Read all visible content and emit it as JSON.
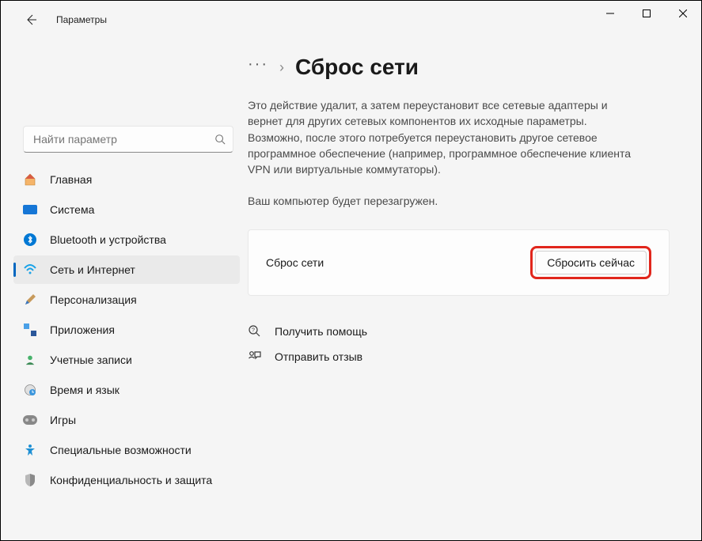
{
  "app_title": "Параметры",
  "search": {
    "placeholder": "Найти параметр"
  },
  "sidebar": {
    "items": [
      {
        "label": "Главная"
      },
      {
        "label": "Система"
      },
      {
        "label": "Bluetooth и устройства"
      },
      {
        "label": "Сеть и Интернет"
      },
      {
        "label": "Персонализация"
      },
      {
        "label": "Приложения"
      },
      {
        "label": "Учетные записи"
      },
      {
        "label": "Время и язык"
      },
      {
        "label": "Игры"
      },
      {
        "label": "Специальные возможности"
      },
      {
        "label": "Конфиденциальность и защита"
      }
    ]
  },
  "breadcrumb": {
    "ellipsis": "···",
    "sep": "›",
    "title": "Сброс сети"
  },
  "main": {
    "description": "Это действие удалит, а затем переустановит все сетевые адаптеры и вернет для других сетевых компонентов их исходные параметры. Возможно, после этого потребуется переустановить другое сетевое программное обеспечение (например, программное обеспечение клиента VPN или виртуальные коммутаторы).",
    "restart_note": "Ваш компьютер будет перезагружен.",
    "card_label": "Сброс сети",
    "reset_button": "Сбросить сейчас"
  },
  "footer": {
    "get_help": "Получить помощь",
    "feedback": "Отправить отзыв"
  }
}
